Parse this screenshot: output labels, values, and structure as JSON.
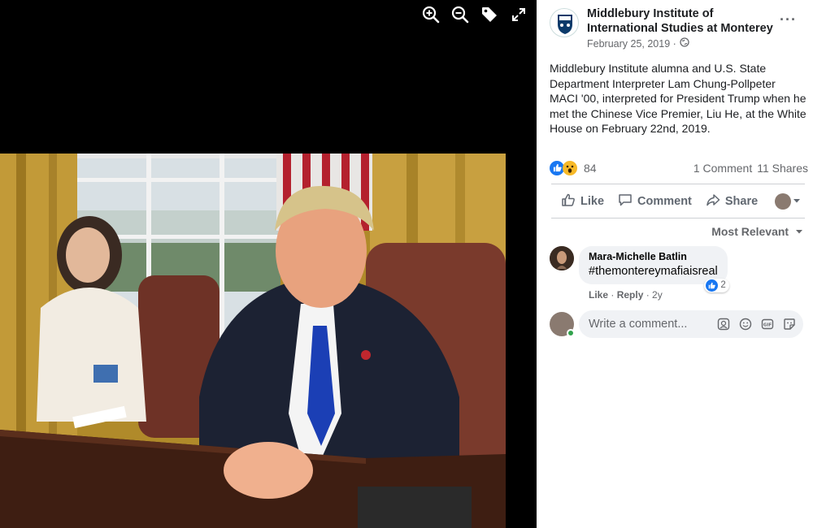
{
  "viewer": {
    "tools": [
      "zoom-in-icon",
      "zoom-out-icon",
      "tag-icon",
      "fullscreen-icon"
    ]
  },
  "post": {
    "page_name": "Middlebury Institute of International Studies at Monterey",
    "date": "February 25, 2019 ·",
    "privacy_icon": "globe-icon",
    "more": "···",
    "text": "Middlebury Institute alumna and U.S. State Department Interpreter Lam Chung-Pollpeter MACI '00, interpreted for President Trump when he met the Chinese Vice Premier, Liu He, at the White House on February 22nd, 2019.",
    "reaction_count": "84",
    "comments_count": "1 Comment",
    "shares_count": "11 Shares"
  },
  "actions": {
    "like": "Like",
    "comment": "Comment",
    "share": "Share"
  },
  "sort": {
    "label": "Most Relevant"
  },
  "comment": {
    "author": "Mara-Michelle Batlin",
    "text": "#themontereymafiaisreal",
    "reaction_count": "2",
    "like": "Like",
    "reply": "Reply",
    "age": "2y"
  },
  "composer": {
    "placeholder": "Write a comment..."
  },
  "colors": {
    "facebook_blue": "#1877f2",
    "wow_yellow": "#f7b928",
    "online_green": "#31a24c"
  }
}
